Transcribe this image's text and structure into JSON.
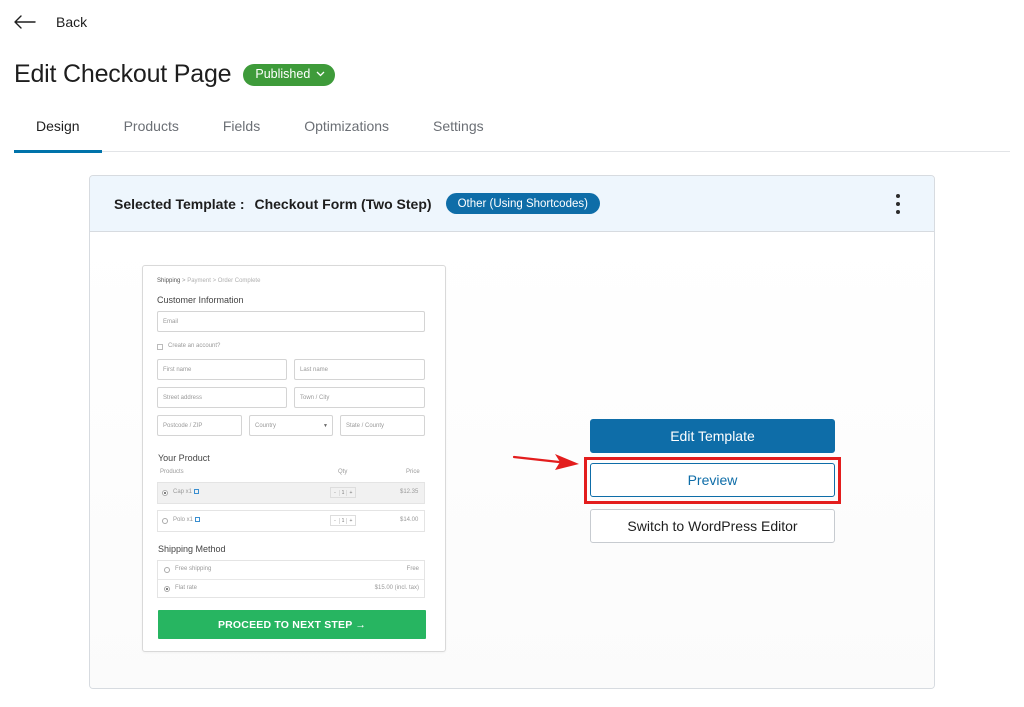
{
  "nav": {
    "back_label": "Back"
  },
  "header": {
    "title": "Edit Checkout Page",
    "status": "Published"
  },
  "tabs": [
    {
      "label": "Design",
      "active": true
    },
    {
      "label": "Products",
      "active": false
    },
    {
      "label": "Fields",
      "active": false
    },
    {
      "label": "Optimizations",
      "active": false
    },
    {
      "label": "Settings",
      "active": false
    }
  ],
  "template_card": {
    "label": "Selected Template",
    "name": "Checkout Form",
    "variant": "(Two Step)",
    "type_badge": "Other (Using Shortcodes)"
  },
  "checkout_preview": {
    "breadcrumb": {
      "active": "Shipping",
      "rest": "Payment  >  Order Complete",
      "sep": ">"
    },
    "customer_heading": "Customer Information",
    "email_placeholder": "Email",
    "create_account_label": "Create an account?",
    "first_name_placeholder": "First name",
    "last_name_placeholder": "Last name",
    "street_placeholder": "Street address",
    "town_placeholder": "Town / City",
    "postcode_placeholder": "Postcode / ZIP",
    "country_placeholder": "Country",
    "state_placeholder": "State / County",
    "product_heading": "Your Product",
    "product_columns": [
      "Products",
      "Qty",
      "Price"
    ],
    "products": [
      {
        "name": "Cap x1",
        "qty": "1",
        "price": "$12.35",
        "selected": true
      },
      {
        "name": "Polo x1",
        "qty": "1",
        "price": "$14.00",
        "selected": false
      }
    ],
    "shipping_heading": "Shipping Method",
    "shipping_options": [
      {
        "name": "Free shipping",
        "price": "Free",
        "selected": false
      },
      {
        "name": "Flat rate",
        "price": "$15.00 (incl. tax)",
        "selected": true
      }
    ],
    "next_button": "PROCEED TO NEXT STEP →"
  },
  "actions": {
    "edit_template": "Edit Template",
    "preview": "Preview",
    "switch_editor": "Switch to WordPress Editor"
  },
  "colors": {
    "accent": "#0e6da8",
    "published": "#3e9b3a",
    "highlight": "#e31d1d",
    "proceed_button": "#27b561"
  }
}
